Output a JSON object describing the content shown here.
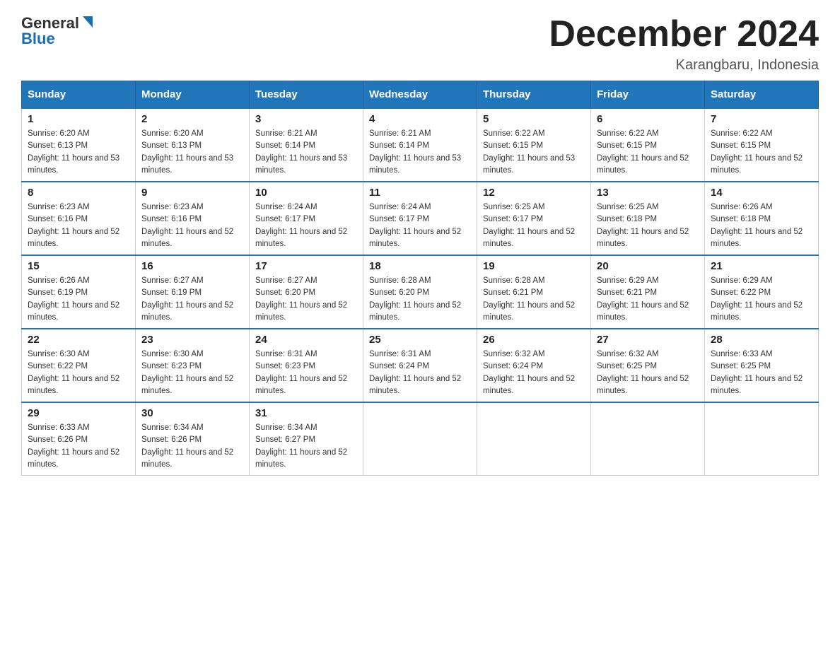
{
  "header": {
    "logo_general": "General",
    "logo_blue": "Blue",
    "title": "December 2024",
    "location": "Karangbaru, Indonesia"
  },
  "days_of_week": [
    "Sunday",
    "Monday",
    "Tuesday",
    "Wednesday",
    "Thursday",
    "Friday",
    "Saturday"
  ],
  "weeks": [
    [
      {
        "day": "1",
        "sunrise": "6:20 AM",
        "sunset": "6:13 PM",
        "daylight": "11 hours and 53 minutes."
      },
      {
        "day": "2",
        "sunrise": "6:20 AM",
        "sunset": "6:13 PM",
        "daylight": "11 hours and 53 minutes."
      },
      {
        "day": "3",
        "sunrise": "6:21 AM",
        "sunset": "6:14 PM",
        "daylight": "11 hours and 53 minutes."
      },
      {
        "day": "4",
        "sunrise": "6:21 AM",
        "sunset": "6:14 PM",
        "daylight": "11 hours and 53 minutes."
      },
      {
        "day": "5",
        "sunrise": "6:22 AM",
        "sunset": "6:15 PM",
        "daylight": "11 hours and 53 minutes."
      },
      {
        "day": "6",
        "sunrise": "6:22 AM",
        "sunset": "6:15 PM",
        "daylight": "11 hours and 52 minutes."
      },
      {
        "day": "7",
        "sunrise": "6:22 AM",
        "sunset": "6:15 PM",
        "daylight": "11 hours and 52 minutes."
      }
    ],
    [
      {
        "day": "8",
        "sunrise": "6:23 AM",
        "sunset": "6:16 PM",
        "daylight": "11 hours and 52 minutes."
      },
      {
        "day": "9",
        "sunrise": "6:23 AM",
        "sunset": "6:16 PM",
        "daylight": "11 hours and 52 minutes."
      },
      {
        "day": "10",
        "sunrise": "6:24 AM",
        "sunset": "6:17 PM",
        "daylight": "11 hours and 52 minutes."
      },
      {
        "day": "11",
        "sunrise": "6:24 AM",
        "sunset": "6:17 PM",
        "daylight": "11 hours and 52 minutes."
      },
      {
        "day": "12",
        "sunrise": "6:25 AM",
        "sunset": "6:17 PM",
        "daylight": "11 hours and 52 minutes."
      },
      {
        "day": "13",
        "sunrise": "6:25 AM",
        "sunset": "6:18 PM",
        "daylight": "11 hours and 52 minutes."
      },
      {
        "day": "14",
        "sunrise": "6:26 AM",
        "sunset": "6:18 PM",
        "daylight": "11 hours and 52 minutes."
      }
    ],
    [
      {
        "day": "15",
        "sunrise": "6:26 AM",
        "sunset": "6:19 PM",
        "daylight": "11 hours and 52 minutes."
      },
      {
        "day": "16",
        "sunrise": "6:27 AM",
        "sunset": "6:19 PM",
        "daylight": "11 hours and 52 minutes."
      },
      {
        "day": "17",
        "sunrise": "6:27 AM",
        "sunset": "6:20 PM",
        "daylight": "11 hours and 52 minutes."
      },
      {
        "day": "18",
        "sunrise": "6:28 AM",
        "sunset": "6:20 PM",
        "daylight": "11 hours and 52 minutes."
      },
      {
        "day": "19",
        "sunrise": "6:28 AM",
        "sunset": "6:21 PM",
        "daylight": "11 hours and 52 minutes."
      },
      {
        "day": "20",
        "sunrise": "6:29 AM",
        "sunset": "6:21 PM",
        "daylight": "11 hours and 52 minutes."
      },
      {
        "day": "21",
        "sunrise": "6:29 AM",
        "sunset": "6:22 PM",
        "daylight": "11 hours and 52 minutes."
      }
    ],
    [
      {
        "day": "22",
        "sunrise": "6:30 AM",
        "sunset": "6:22 PM",
        "daylight": "11 hours and 52 minutes."
      },
      {
        "day": "23",
        "sunrise": "6:30 AM",
        "sunset": "6:23 PM",
        "daylight": "11 hours and 52 minutes."
      },
      {
        "day": "24",
        "sunrise": "6:31 AM",
        "sunset": "6:23 PM",
        "daylight": "11 hours and 52 minutes."
      },
      {
        "day": "25",
        "sunrise": "6:31 AM",
        "sunset": "6:24 PM",
        "daylight": "11 hours and 52 minutes."
      },
      {
        "day": "26",
        "sunrise": "6:32 AM",
        "sunset": "6:24 PM",
        "daylight": "11 hours and 52 minutes."
      },
      {
        "day": "27",
        "sunrise": "6:32 AM",
        "sunset": "6:25 PM",
        "daylight": "11 hours and 52 minutes."
      },
      {
        "day": "28",
        "sunrise": "6:33 AM",
        "sunset": "6:25 PM",
        "daylight": "11 hours and 52 minutes."
      }
    ],
    [
      {
        "day": "29",
        "sunrise": "6:33 AM",
        "sunset": "6:26 PM",
        "daylight": "11 hours and 52 minutes."
      },
      {
        "day": "30",
        "sunrise": "6:34 AM",
        "sunset": "6:26 PM",
        "daylight": "11 hours and 52 minutes."
      },
      {
        "day": "31",
        "sunrise": "6:34 AM",
        "sunset": "6:27 PM",
        "daylight": "11 hours and 52 minutes."
      },
      null,
      null,
      null,
      null
    ]
  ]
}
